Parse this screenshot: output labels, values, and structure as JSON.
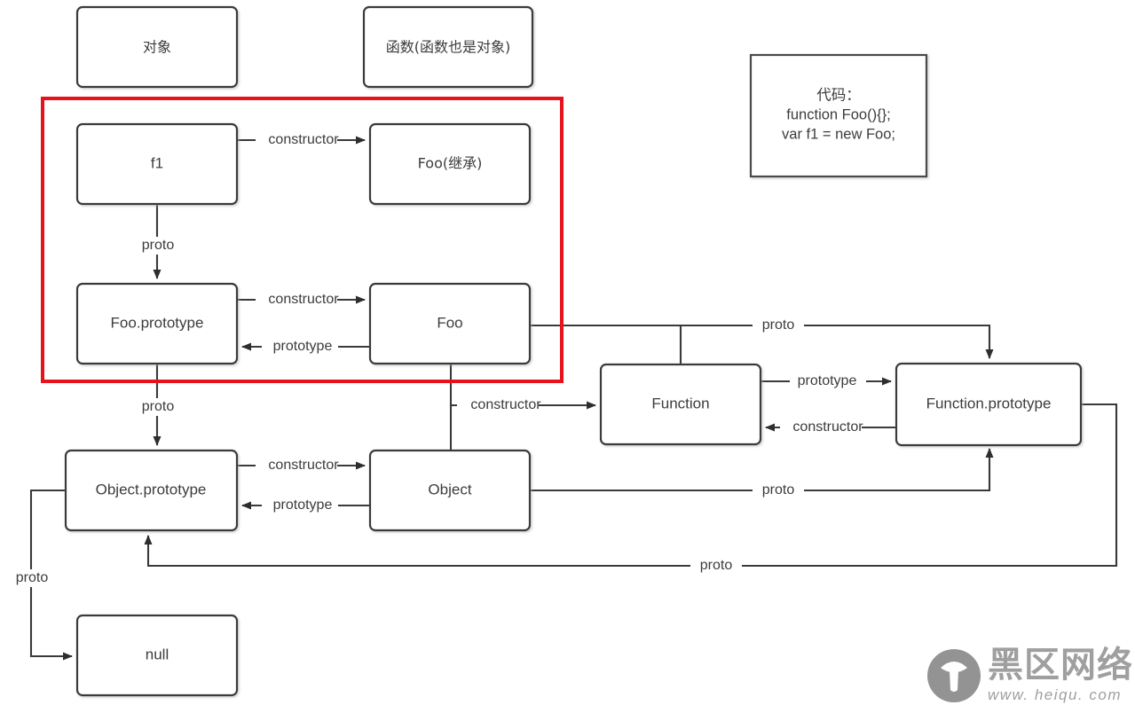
{
  "diagram": {
    "title": "JavaScript prototype chain diagram",
    "colors": {
      "box_stroke": "#3a3a3a",
      "highlight": "#e8121a",
      "text": "#3c3c3c",
      "background": "#ffffff",
      "watermark": "#9a9a9a"
    },
    "legend_boxes": [
      {
        "id": "legend-object",
        "label": "对象"
      },
      {
        "id": "legend-function",
        "label": "函数(函数也是对象)"
      }
    ],
    "code_box": {
      "line1": "代码：",
      "line2": "function Foo(){};",
      "line3": "var  f1  =  new Foo;"
    },
    "nodes": [
      {
        "id": "f1",
        "label": "f1"
      },
      {
        "id": "foo-inherit",
        "label": "Foo(继承)"
      },
      {
        "id": "foo-prototype",
        "label": "Foo.prototype"
      },
      {
        "id": "foo",
        "label": "Foo"
      },
      {
        "id": "function",
        "label": "Function"
      },
      {
        "id": "function-prototype",
        "label": "Function.prototype"
      },
      {
        "id": "object-prototype",
        "label": "Object.prototype"
      },
      {
        "id": "object",
        "label": "Object"
      },
      {
        "id": "null",
        "label": "null"
      }
    ],
    "edges": [
      {
        "id": "e1",
        "from": "f1",
        "to": "foo-inherit",
        "label": "constructor"
      },
      {
        "id": "e2",
        "from": "f1",
        "to": "foo-prototype",
        "label": "proto"
      },
      {
        "id": "e3",
        "from": "foo-prototype",
        "to": "foo",
        "label": "constructor"
      },
      {
        "id": "e4",
        "from": "foo",
        "to": "foo-prototype",
        "label": "prototype"
      },
      {
        "id": "e5",
        "from": "foo-prototype",
        "to": "object-prototype",
        "label": "proto"
      },
      {
        "id": "e6",
        "from": "foo",
        "to": "function-prototype",
        "label": "proto"
      },
      {
        "id": "e7",
        "from": "foo",
        "to": "function",
        "label": "constructor"
      },
      {
        "id": "e8",
        "from": "function",
        "to": "function-prototype",
        "label": "prototype"
      },
      {
        "id": "e9",
        "from": "function-prototype",
        "to": "function",
        "label": "constructor"
      },
      {
        "id": "e10",
        "from": "object-prototype",
        "to": "object",
        "label": "constructor"
      },
      {
        "id": "e11",
        "from": "object",
        "to": "object-prototype",
        "label": "prototype"
      },
      {
        "id": "e12",
        "from": "object",
        "to": "function-prototype",
        "label": "proto"
      },
      {
        "id": "e13",
        "from": "function-prototype",
        "to": "object-prototype",
        "label": "proto"
      },
      {
        "id": "e14",
        "from": "object-prototype",
        "to": "null",
        "label": "proto"
      }
    ],
    "highlight_region": {
      "id": "highlight-red-box",
      "contains": [
        "f1",
        "foo-inherit",
        "foo-prototype",
        "foo"
      ]
    },
    "watermark": {
      "brand": "黑区网络",
      "url": "www. heiqu. com"
    }
  }
}
